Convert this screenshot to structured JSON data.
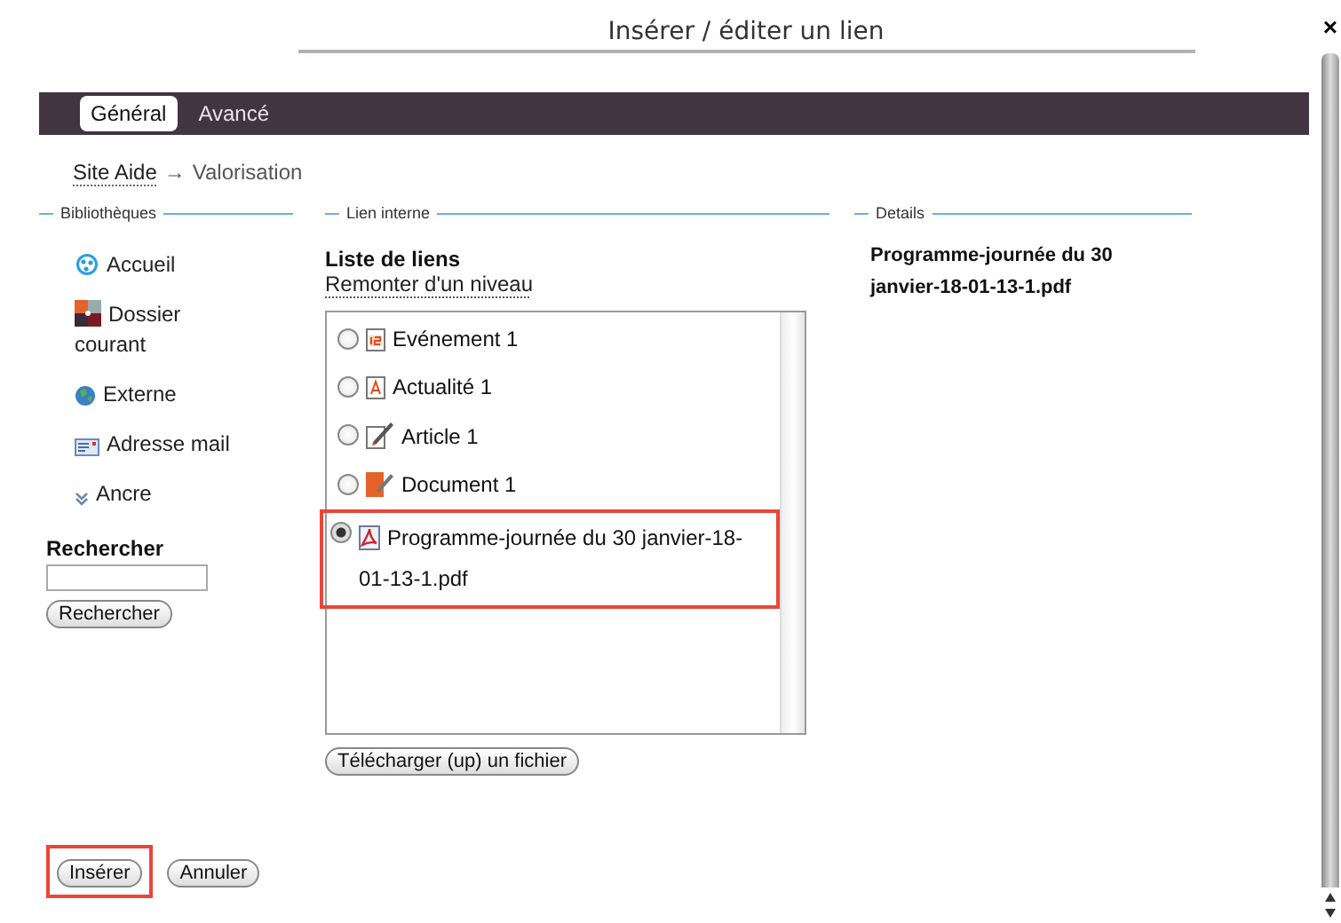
{
  "dialog": {
    "title": "Insérer / éditer un lien",
    "close": "×"
  },
  "tabs": [
    {
      "label": "Général",
      "selected": true
    },
    {
      "label": "Avancé",
      "selected": false
    }
  ],
  "breadcrumb": {
    "link": "Site Aide",
    "separator": "→",
    "current": "Valorisation"
  },
  "libraries": {
    "legend": "Bibliothèques",
    "items": [
      {
        "label": "Accueil",
        "kind": "home"
      },
      {
        "label": "Dossier courant",
        "kind": "folder"
      },
      {
        "label": "Externe",
        "kind": "globe"
      },
      {
        "label": "Adresse mail",
        "kind": "mail"
      },
      {
        "label": "Ancre",
        "kind": "anchor"
      }
    ]
  },
  "search": {
    "label": "Rechercher",
    "button": "Rechercher"
  },
  "internal_link": {
    "legend": "Lien interne",
    "heading": "Liste de liens",
    "up_link": "Remonter d'un niveau",
    "items": [
      {
        "label": "Evénement 1",
        "kind": "event",
        "selected": false,
        "highlighted": false
      },
      {
        "label": "Actualité 1",
        "kind": "news",
        "selected": false,
        "highlighted": false
      },
      {
        "label": "Article 1",
        "kind": "article",
        "selected": false,
        "highlighted": false
      },
      {
        "label": "Document 1",
        "kind": "document",
        "selected": false,
        "highlighted": false
      },
      {
        "label": "Programme-journée du 30 janvier-18-01-13-1.pdf",
        "kind": "pdf",
        "selected": true,
        "highlighted": true
      }
    ],
    "upload_button": "Télécharger (up) un fichier"
  },
  "details": {
    "legend": "Details",
    "text": "Programme-journée du 30 janvier-18-01-13-1.pdf"
  },
  "buttons": [
    {
      "label": "Insérer",
      "highlighted": true
    },
    {
      "label": "Annuler",
      "highlighted": false
    }
  ]
}
